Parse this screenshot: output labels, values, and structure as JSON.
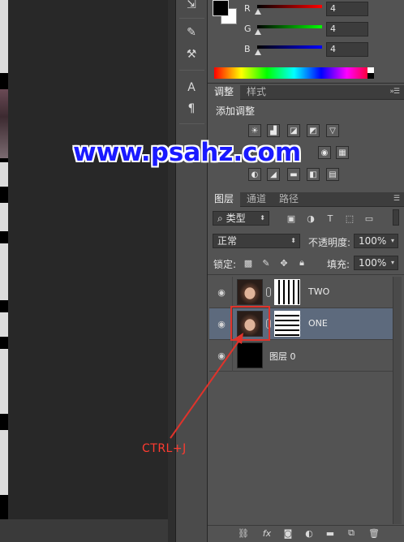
{
  "color_panel": {
    "channels": [
      {
        "label": "R",
        "value": "4"
      },
      {
        "label": "G",
        "value": "4"
      },
      {
        "label": "B",
        "value": "4"
      }
    ],
    "fg_color": "#000000",
    "bg_color": "#ffffff"
  },
  "adjustments": {
    "tabs": [
      "调整",
      "样式"
    ],
    "title": "添加调整"
  },
  "watermark": "www.psahz.com",
  "layers_panel": {
    "tabs": [
      "图层",
      "通道",
      "路径"
    ],
    "filter_kind": "类型",
    "blend_mode": "正常",
    "opacity_label": "不透明度:",
    "opacity_value": "100%",
    "lock_label": "锁定:",
    "fill_label": "填充:",
    "fill_value": "100%",
    "layers": [
      {
        "name": "TWO",
        "visible": true,
        "selected": false,
        "mask": "vertical-stripes"
      },
      {
        "name": "ONE",
        "visible": true,
        "selected": true,
        "mask": "horizontal-stripes"
      },
      {
        "name": "图层 0",
        "visible": true,
        "selected": false,
        "mask": null
      }
    ]
  },
  "annotation": {
    "label": "CTRL+J",
    "color": "#ff3b30"
  }
}
